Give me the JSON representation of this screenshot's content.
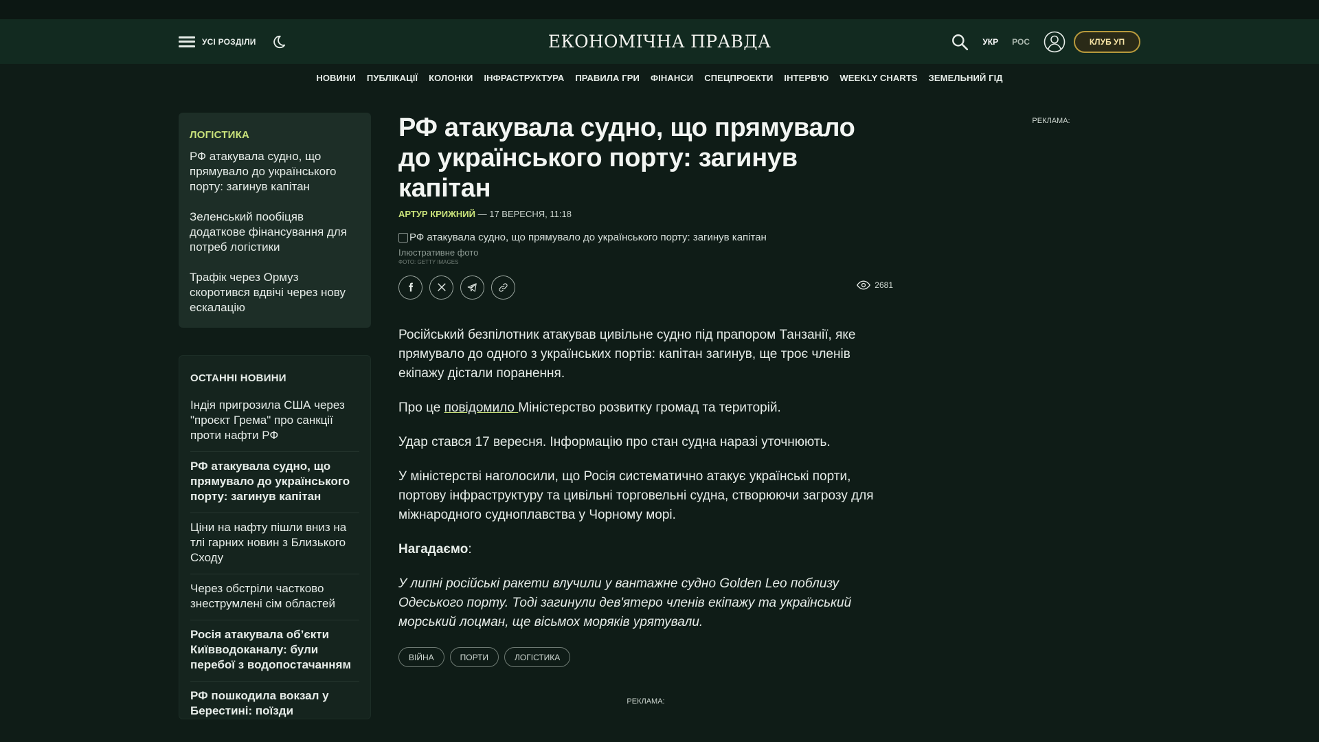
{
  "header": {
    "sections_label": "УСІ РОЗДІЛИ",
    "logo": "ЕКОНОМІЧНА ПРАВДА",
    "lang_active": "УКР",
    "lang_inactive": "РОС",
    "club_label": "КЛУБ УП"
  },
  "nav": [
    "НОВИНИ",
    "ПУБЛІКАЦІЇ",
    "КОЛОНКИ",
    "ІНФРАСТРУКТУРА",
    "ПРАВИЛА ГРИ",
    "ФІНАНСИ",
    "СПЕЦПРОЕКТИ",
    "ІНТЕРВ'Ю",
    "WEEKLY CHARTS",
    "ЗЕМЕЛЬНИЙ ГІД"
  ],
  "sidebar": {
    "category_title": "ЛОГІСТИКА",
    "category_items": [
      "РФ атакувала судно, що прямувало до українського порту: загинув капітан",
      "Зеленський пообіцяв додаткове фінансування для потреб логістики",
      "Трафік через Ормуз скоротився вдвічі через нову ескалацію"
    ],
    "latest_title": "ОСТАННІ НОВИНИ",
    "latest_items": [
      "Індія пригрозила США через \"проєкт Грема\" про санкції проти нафти РФ",
      "РФ атакувала судно, що прямувало до українського порту: загинув капітан",
      "Ціни на нафту пішли вниз на тлі гарних новин з Близького Сходу",
      "Через обстріли частково знеструмлені сім областей",
      "Росія атакувала об’єкти Київводоканалу: були перебої з водопостачанням",
      "РФ пошкодила вокзал у Берестині: поїзди затримаються до шести"
    ]
  },
  "article": {
    "headline": "РФ атакувала судно, що прямувало до українського порту: загинув капітан",
    "author": "АРТУР КРИЖНИЙ",
    "date": " — 17 ВЕРЕСНЯ, 11:18",
    "image_alt": "РФ атакувала судно, що прямувало до українського порту: загинув капітан",
    "caption": "Ілюстративне фото",
    "photo_credit": "ФОТО: GETTY IMAGES",
    "views": "2681",
    "p1": "Російський безпілотник атакував цивільне судно під прапором Танзанії, яке прямувало до одного з українських портів: капітан загинув, ще троє членів екіпажу дістали поранення.",
    "p2_prefix": "Про це ",
    "p2_link": "повідомило ",
    "p2_suffix": "Міністерство розвитку громад та територій.",
    "p3": "Удар стався 17 вересня. Інформацію про стан судна наразі уточнюють.",
    "p4": "У міністерстві наголосили, що Росія систематично атакує українські порти, портову інфраструктуру та цивільні торговельні судна, створюючи загрозу для міжнародного судноплавства у Чорному морі.",
    "p5": "Нагадаємо",
    "p5_colon": ":",
    "p6": "У липні російські ракети влучили у вантажне судно Golden Leo поблизу Одеського порту. Тоді загинули дев'ятеро членів екіпажу та український морський лоцман, ще вісьмох моряків урятували.",
    "tags": [
      "ВІЙНА",
      "ПОРТИ",
      "ЛОГІСТИКА"
    ],
    "ad_label": "РЕКЛАМА:"
  },
  "right_ad_label": "РЕКЛАМА:",
  "colors": {
    "accent": "#c9e27a",
    "header_bg": "#122a20",
    "page_bg": "#0f1c17",
    "club_border": "#b89a3c"
  }
}
